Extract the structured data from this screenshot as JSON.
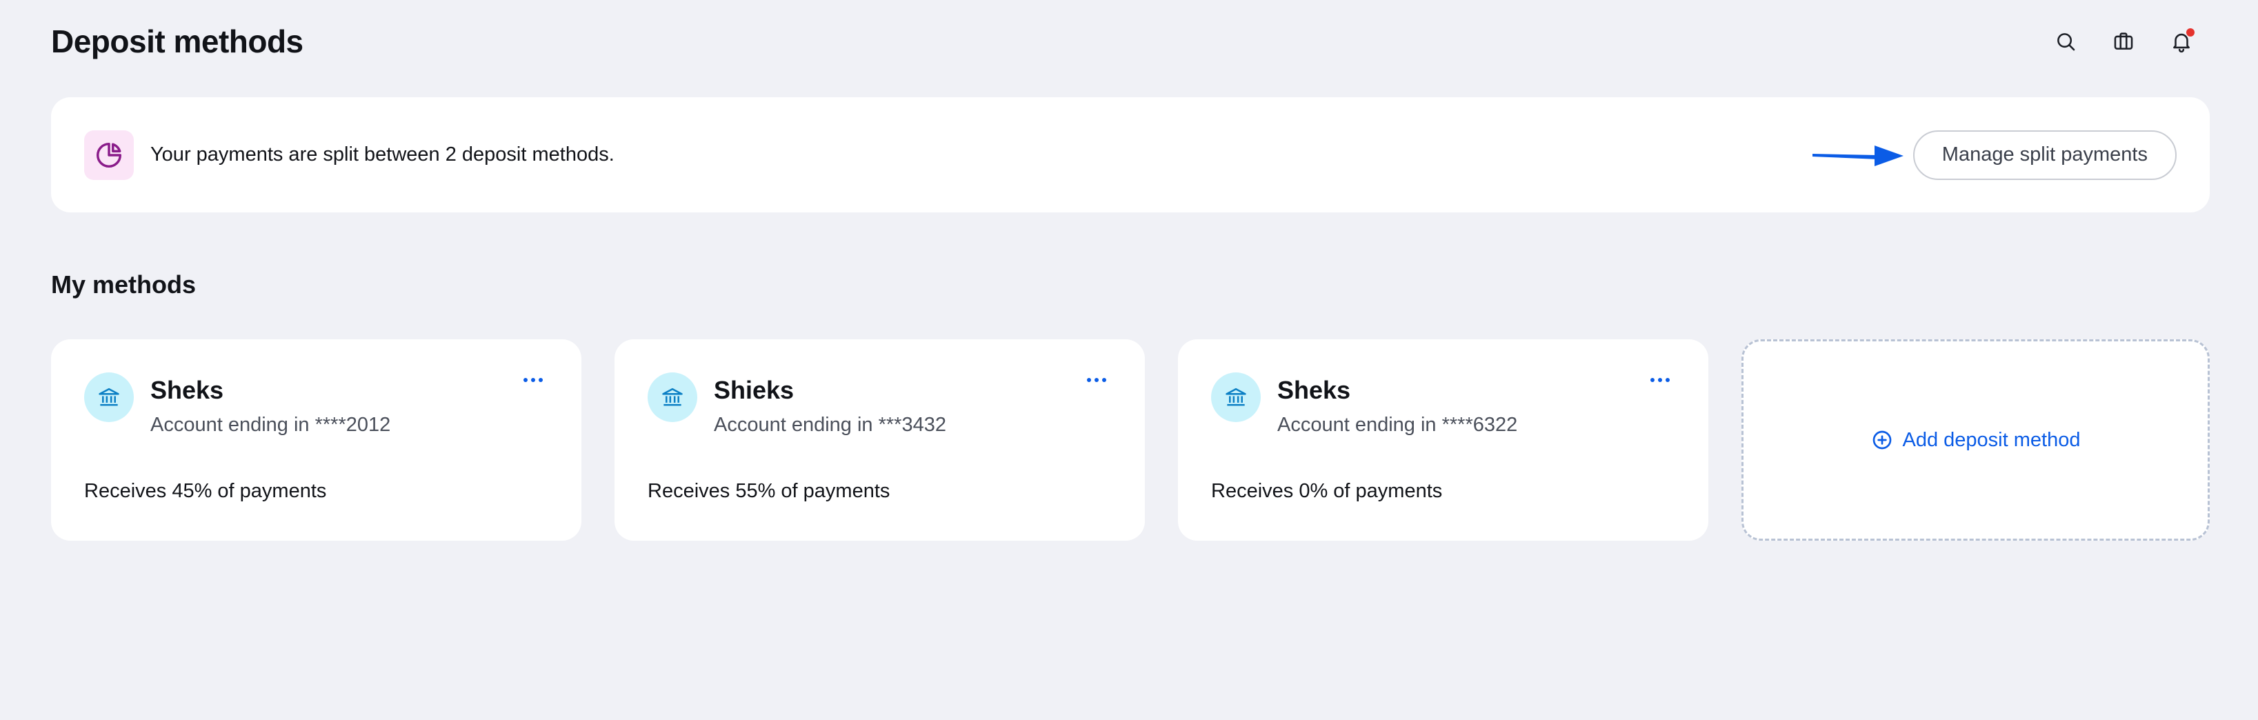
{
  "header": {
    "title": "Deposit methods",
    "icons": [
      "search-icon",
      "briefcase-icon",
      "bell-icon"
    ],
    "notification_color": "#e5322d"
  },
  "banner": {
    "icon": "pie-chart-icon",
    "text": "Your payments are split between 2 deposit methods.",
    "button_label": "Manage split payments",
    "annotation_color": "#0b5ce6"
  },
  "section": {
    "title": "My methods"
  },
  "methods": [
    {
      "name": "Sheks",
      "account": "Account ending in ****2012",
      "share": "Receives 45% of payments",
      "share_percent": 45,
      "icon": "bank-icon"
    },
    {
      "name": "Shieks",
      "account": "Account ending in ***3432",
      "share": "Receives 55% of payments",
      "share_percent": 55,
      "icon": "bank-icon"
    },
    {
      "name": "Sheks",
      "account": "Account ending in ****6322",
      "share": "Receives 0% of payments",
      "share_percent": 0,
      "icon": "bank-icon"
    }
  ],
  "add_method": {
    "label": "Add deposit method",
    "icon": "plus-circle-icon"
  },
  "colors": {
    "accent": "#0b5ce6",
    "background": "#f0f1f6",
    "bank_avatar": "#c9f2fb",
    "banner_icon_bg": "#fbe5f7",
    "pie_icon": "#8a1c8a"
  }
}
